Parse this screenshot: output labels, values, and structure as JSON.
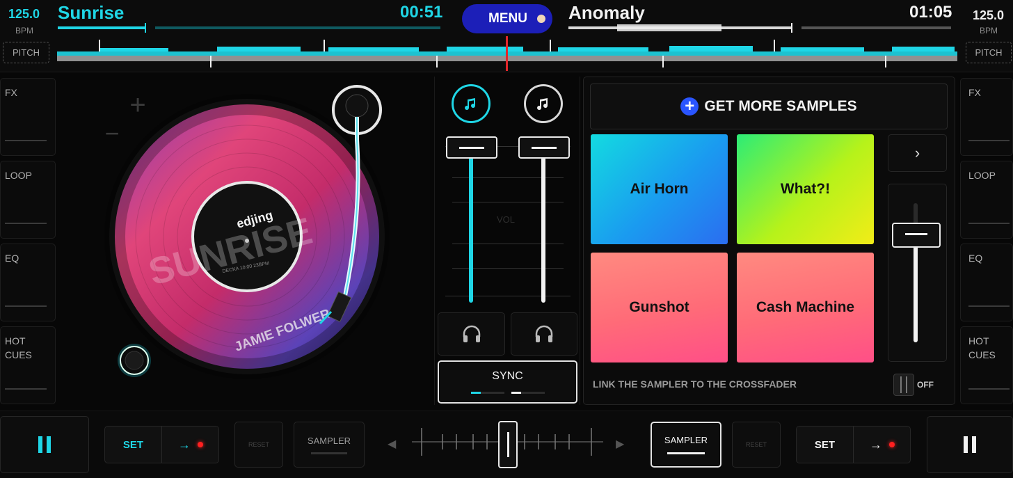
{
  "deck_left": {
    "bpm": "125.0",
    "bpm_unit": "BPM",
    "pitch_label": "PITCH",
    "title": "Sunrise",
    "time": "00:51",
    "side_buttons": [
      "FX",
      "LOOP",
      "EQ",
      "HOT\nCUES"
    ],
    "record": {
      "brand": "edjing",
      "small_text": "DECKA 10:00 23BPM",
      "artist": "JAMIE FOLWER",
      "cover_word": "SUNRISE"
    },
    "set_label": "SET",
    "reset_label": "RESET",
    "sampler_label": "SAMPLER",
    "accent": "#1fd6e6"
  },
  "deck_right": {
    "bpm": "125.0",
    "bpm_unit": "BPM",
    "pitch_label": "PITCH",
    "title": "Anomaly",
    "time": "01:05",
    "side_buttons": [
      "FX",
      "LOOP",
      "EQ",
      "HOT\nCUES"
    ],
    "set_label": "SET",
    "reset_label": "RESET",
    "sampler_label": "SAMPLER",
    "accent": "#ffffff"
  },
  "menu": {
    "label": "MENU",
    "color": "#1c1fb8"
  },
  "mixer": {
    "vol_label": "VOL",
    "sync_label": "SYNC"
  },
  "sampler": {
    "get_more_label": "GET MORE SAMPLES",
    "next_label": "›",
    "pads": [
      {
        "label": "Air Horn"
      },
      {
        "label": "What?!"
      },
      {
        "label": "Gunshot"
      },
      {
        "label": "Cash Machine"
      }
    ],
    "link_label": "LINK THE SAMPLER TO THE CROSSFADER",
    "link_state": "OFF"
  },
  "icons": {
    "play_pause": "pause-icon",
    "headphones": "headphones-icon",
    "music_note": "music-note-icon",
    "arrow_right": "arrow-right-icon",
    "plus": "plus-icon"
  }
}
